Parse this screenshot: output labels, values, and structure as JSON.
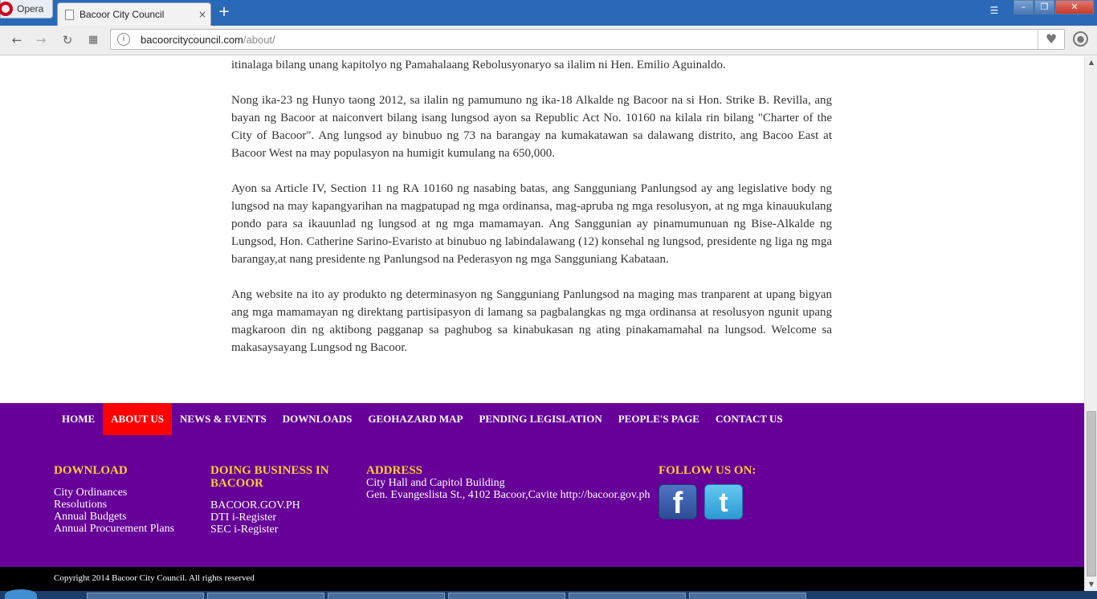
{
  "browser": {
    "opera_label": "Opera",
    "tab_title": "Bacoor City Council",
    "tab_close": "×",
    "new_tab": "+",
    "url_host": "bacoorcitycouncil.com",
    "url_path": "/about/",
    "icons": [
      "back-icon",
      "forward-icon",
      "reload-icon",
      "speed-dial-icon",
      "site-info-icon",
      "heart-icon",
      "account-icon"
    ]
  },
  "article": {
    "paragraphs": [
      "itinalaga bilang unang kapitolyo ng Pamahalaang Rebolusyonaryo sa ilalim ni Hen. Emilio Aguinaldo.",
      "Nong ika-23 ng Hunyo taong 2012, sa ilalin ng pamumuno ng ika-18 Alkalde ng Bacoor na si Hon. Strike B. Revilla, ang bayan ng Bacoor at naiconvert bilang isang lungsod ayon sa Republic Act No. 10160 na kilala rin bilang \"Charter of the City of Bacoor\". Ang lungsod ay binubuo ng 73 na barangay na kumakatawan sa dalawang distrito, ang Bacoo East at Bacoor West na may populasyon na humigit kumulang na 650,000.",
      "Ayon sa Article IV, Section 11 ng RA 10160 ng nasabing batas, ang Sangguniang Panlungsod ay ang legislative body ng lungsod na may kapangyarihan na magpatupad ng mga ordinansa, mag-apruba ng mga resolusyon, at ng mga kinauukulang pondo para sa ikauunlad ng lungsod at ng mga mamamayan. Ang Sanggunian ay pinamumunuan ng Bise-Alkalde ng Lungsod, Hon. Catherine Sarino-Evaristo at binubuo ng labindalawang (12) konsehal ng lungsod, presidente ng liga ng mga barangay,at nang presidente ng Panlungsod na Pederasyon ng mga Sangguniang Kabataan.",
      "Ang website na ito ay produkto ng determinasyon ng Sangguniang Panlungsod na maging mas tranparent at upang bigyan ang mga mamamayan ng direktang partisipasyon di lamang sa pagbalangkas ng mga ordinansa at resolusyon ngunit upang magkaroon din ng aktibong pagganap sa paghubog sa kinabukasan ng ating pinakamamahal na lungsod. Welcome sa makasaysayang Lungsod ng Bacoor."
    ]
  },
  "footer_nav": {
    "items": [
      "HOME",
      "ABOUT US",
      "NEWS & EVENTS",
      "DOWNLOADS",
      "GEOHAZARD MAP",
      "PENDING LEGISLATION",
      "PEOPLE'S PAGE",
      "CONTACT US"
    ],
    "active": "ABOUT US"
  },
  "footer": {
    "download": {
      "heading": "DOWNLOAD",
      "links": [
        "City Ordinances",
        "Resolutions",
        "Annual Budgets",
        "Annual Procurement Plans"
      ]
    },
    "business": {
      "heading": "DOING BUSINESS IN BACOOR",
      "links": [
        "BACOOR.GOV.PH",
        "DTI i-Register",
        "SEC i-Register"
      ]
    },
    "address": {
      "heading": "ADDRESS",
      "line1": "City Hall and Capitol Building",
      "line2": "Gen. Evangeslista St., 4102 Bacoor,Cavite http://bacoor.gov.ph"
    },
    "follow": {
      "heading": "FOLLOW US ON:",
      "facebook": "f",
      "twitter": "t"
    },
    "copyright": "Copyright 2014 Bacoor City Council. All rights reserved"
  },
  "colors": {
    "footer_bg": "#660099",
    "active_nav": "#ff0000",
    "heading_yellow": "#ffcc33",
    "tabstrip": "#2a69b7"
  }
}
